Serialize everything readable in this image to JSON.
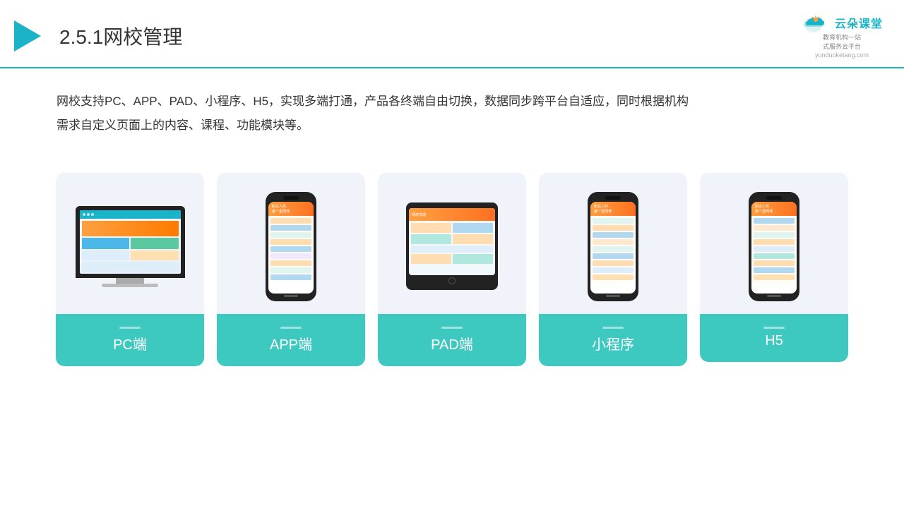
{
  "header": {
    "title_number": "2.5.1",
    "title_main": "网校管理",
    "logo_text": "云朵课堂",
    "logo_subtitle_line1": "教育机构一站",
    "logo_subtitle_line2": "式服务云平台",
    "logo_url": "yunduoketang.com"
  },
  "description": {
    "text": "网校支持PC、APP、PAD、小程序、H5，实现多端打通，产品各终端自由切换，数据同步跨平台自适应，同时根据机构",
    "text2": "需求自定义页面上的内容、课程、功能模块等。"
  },
  "cards": [
    {
      "id": "pc",
      "label": "PC端",
      "type": "pc"
    },
    {
      "id": "app",
      "label": "APP端",
      "type": "phone"
    },
    {
      "id": "pad",
      "label": "PAD端",
      "type": "tablet"
    },
    {
      "id": "miniprogram",
      "label": "小程序",
      "type": "phone"
    },
    {
      "id": "h5",
      "label": "H5",
      "type": "phone"
    }
  ],
  "brand_color": "#3dc8c0",
  "accent_color": "#1ab3c8"
}
